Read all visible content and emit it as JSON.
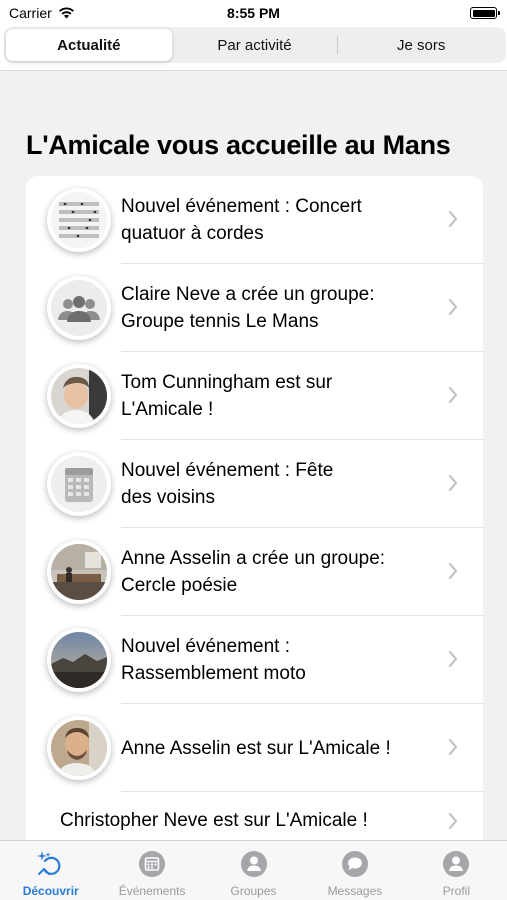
{
  "status_bar": {
    "carrier": "Carrier",
    "time": "8:55 PM"
  },
  "segments": [
    {
      "label": "Actualité",
      "active": true
    },
    {
      "label": "Par activité",
      "active": false
    },
    {
      "label": "Je sors",
      "active": false
    }
  ],
  "page_title": "L'Amicale vous accueille au Mans",
  "feed": [
    {
      "line1": "Nouvel événement : Concert",
      "line2": "quatuor à cordes",
      "icon": "sheet-music-thumbnail"
    },
    {
      "line1": "Claire Neve a crée un groupe:",
      "line2": "Groupe tennis Le Mans",
      "icon": "group-icon"
    },
    {
      "line1": "Tom Cunningham est sur",
      "line2": "L'Amicale !",
      "icon": "user-photo"
    },
    {
      "line1": "Nouvel événement : Fête",
      "line2": "des voisins",
      "icon": "calendar-icon"
    },
    {
      "line1": "Anne Asselin a crée un groupe:",
      "line2": "Cercle poésie",
      "icon": "room-photo"
    },
    {
      "line1": "Nouvel événement :",
      "line2": "Rassemblement moto",
      "icon": "landscape-photo"
    },
    {
      "line1": "Anne Asselin est sur L'Amicale !",
      "line2": "",
      "icon": "user-photo"
    },
    {
      "line1": "Christopher Neve est sur L'Amicale !",
      "line2": "",
      "icon": ""
    }
  ],
  "tabs": [
    {
      "label": "Découvrir",
      "active": true,
      "icon": "discover-icon"
    },
    {
      "label": "Événements",
      "active": false,
      "icon": "events-icon"
    },
    {
      "label": "Groupes",
      "active": false,
      "icon": "groups-icon"
    },
    {
      "label": "Messages",
      "active": false,
      "icon": "messages-icon"
    },
    {
      "label": "Profil",
      "active": false,
      "icon": "profile-icon"
    }
  ],
  "colors": {
    "accent": "#2c7bd6",
    "tab_inactive": "#9a9a9f",
    "background": "#f1f1f4"
  }
}
